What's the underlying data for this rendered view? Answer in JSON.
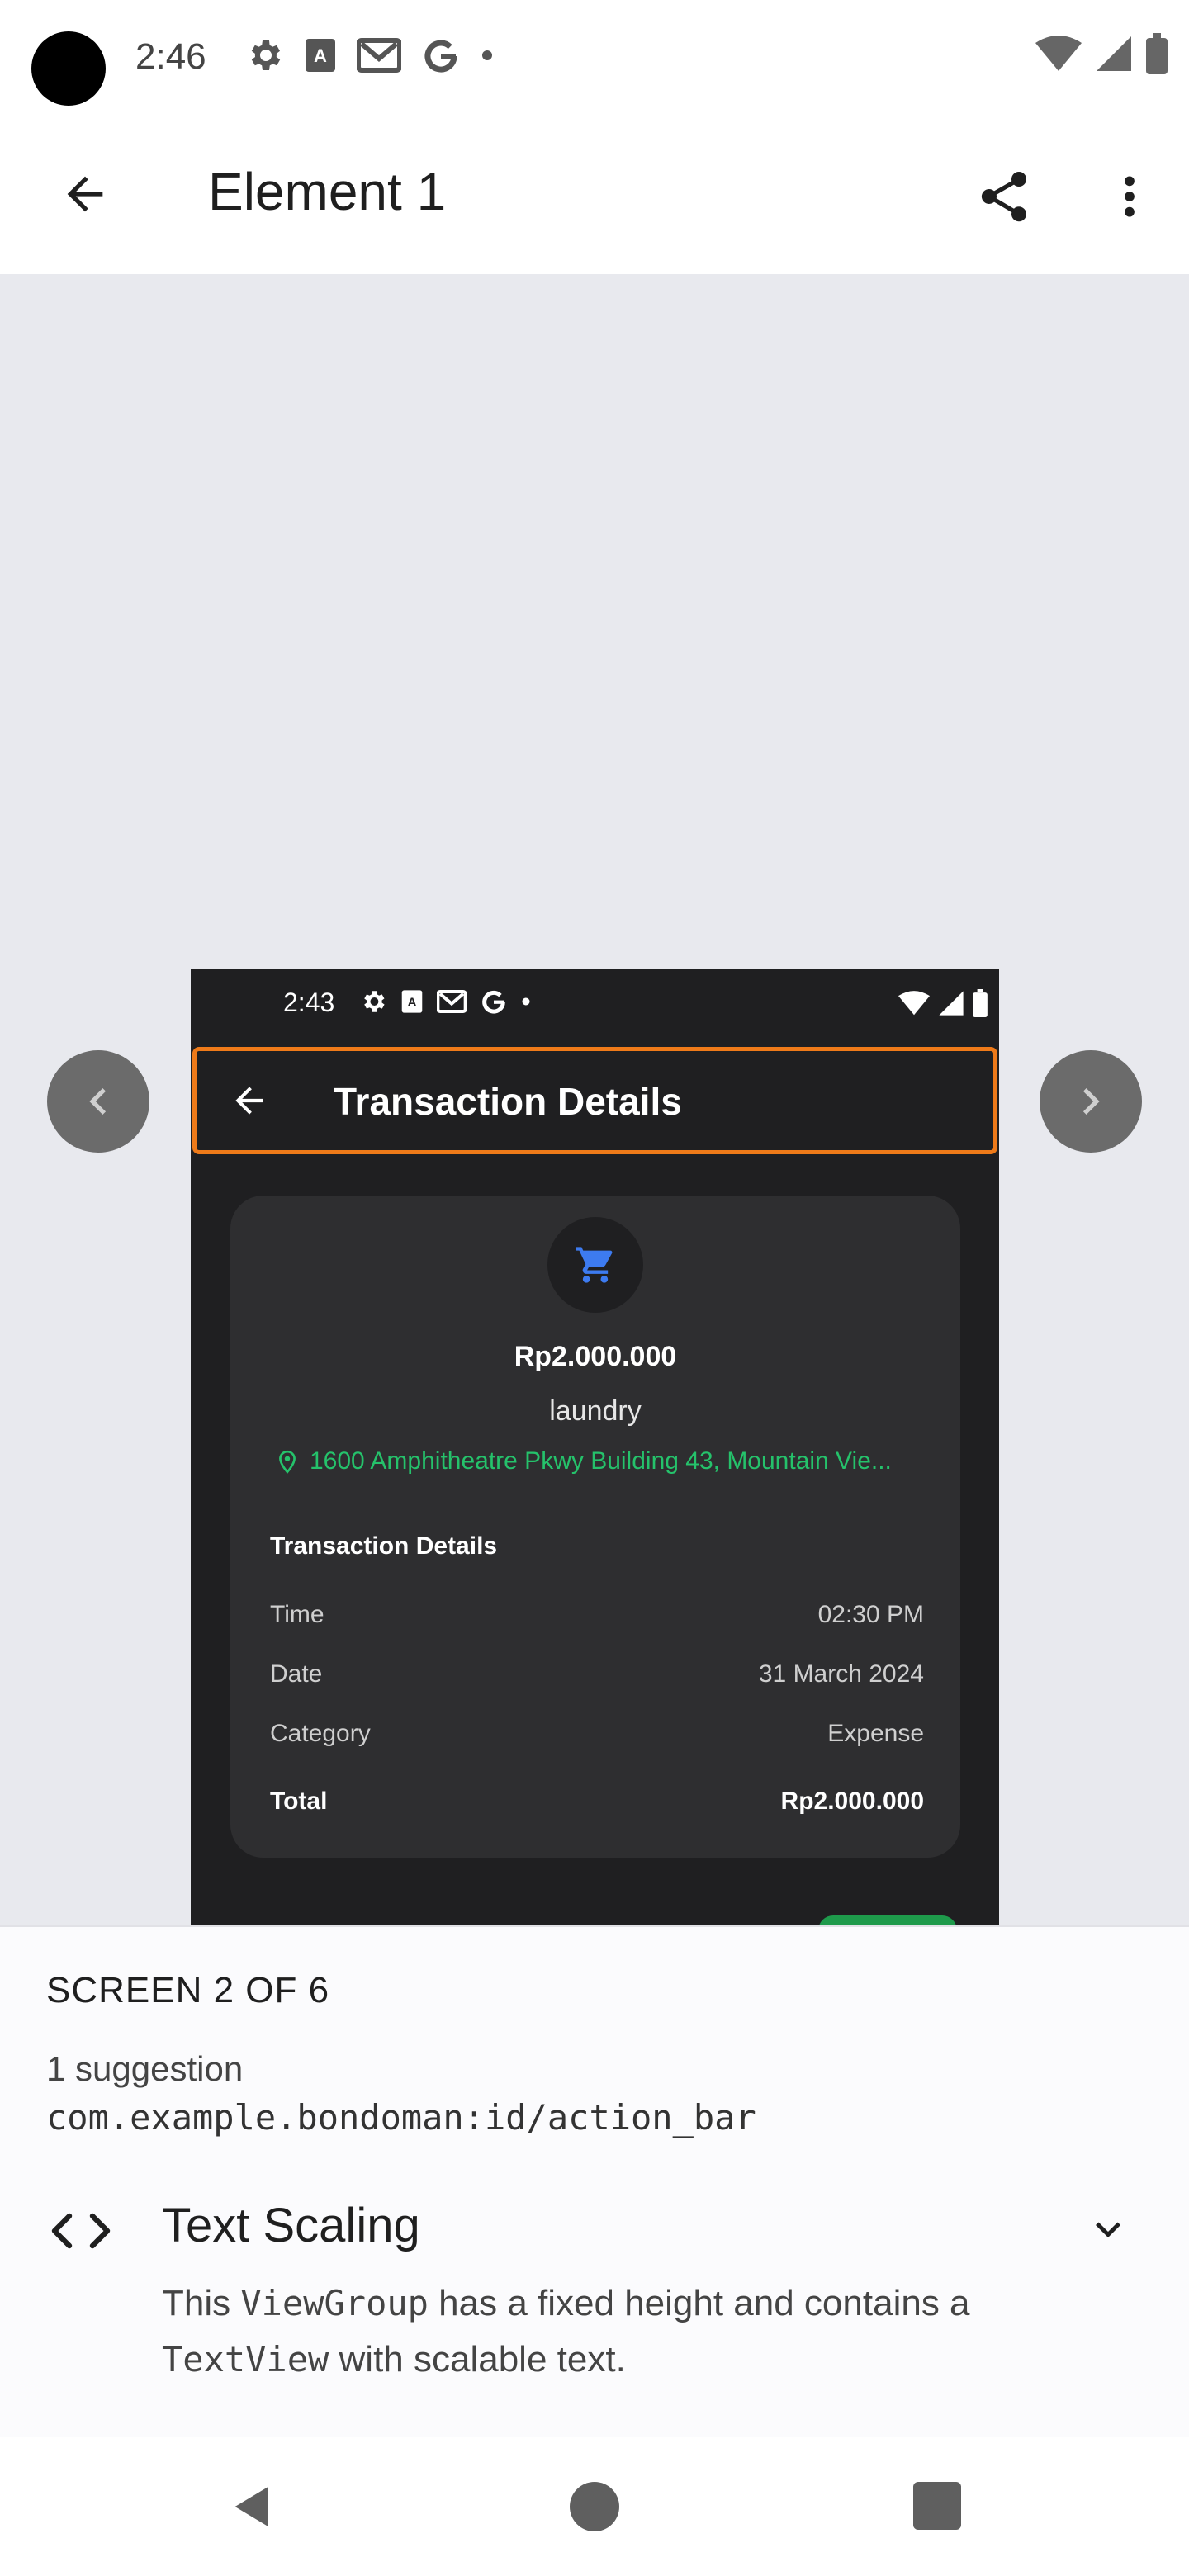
{
  "status_bar": {
    "time": "2:46",
    "icons": [
      "settings-icon",
      "font-icon",
      "gmail-icon",
      "google-icon",
      "dot-icon",
      "wifi-icon",
      "signal-icon",
      "battery-icon"
    ]
  },
  "app_bar": {
    "title": "Element 1",
    "icons": [
      "back-arrow-icon",
      "share-icon",
      "more-vert-icon"
    ]
  },
  "preview": {
    "status_time": "2:43",
    "action_bar_title": "Transaction Details",
    "highlight_color": "#ee7a19",
    "card": {
      "amount": "Rp2.000.000",
      "name": "laundry",
      "location": "1600 Amphitheatre Pkwy Building 43, Mountain Vie...",
      "section_title": "Transaction Details",
      "rows": [
        {
          "label": "Time",
          "value": "02:30 PM"
        },
        {
          "label": "Date",
          "value": "31 March 2024"
        },
        {
          "label": "Category",
          "value": "Expense"
        }
      ],
      "total": {
        "label": "Total",
        "value": "Rp2.000.000"
      }
    },
    "colors": {
      "accent_green": "#25c26b",
      "cart_blue": "#3d7bf0",
      "card_bg": "#2e2e30"
    }
  },
  "sheet": {
    "screen_count": "SCREEN 2 OF 6",
    "suggestion_count": "1 suggestion",
    "resource_id": "com.example.bondoman:id/action_bar",
    "issue_title": "Text Scaling",
    "desc_1": "This ",
    "desc_code_1": "ViewGroup",
    "desc_2": " has a fixed height and contains a ",
    "desc_code_2": "TextView",
    "desc_3": " with scalable text."
  },
  "nav_bar": {
    "icons": [
      "nav-back-icon",
      "nav-home-icon",
      "nav-recents-icon"
    ]
  }
}
